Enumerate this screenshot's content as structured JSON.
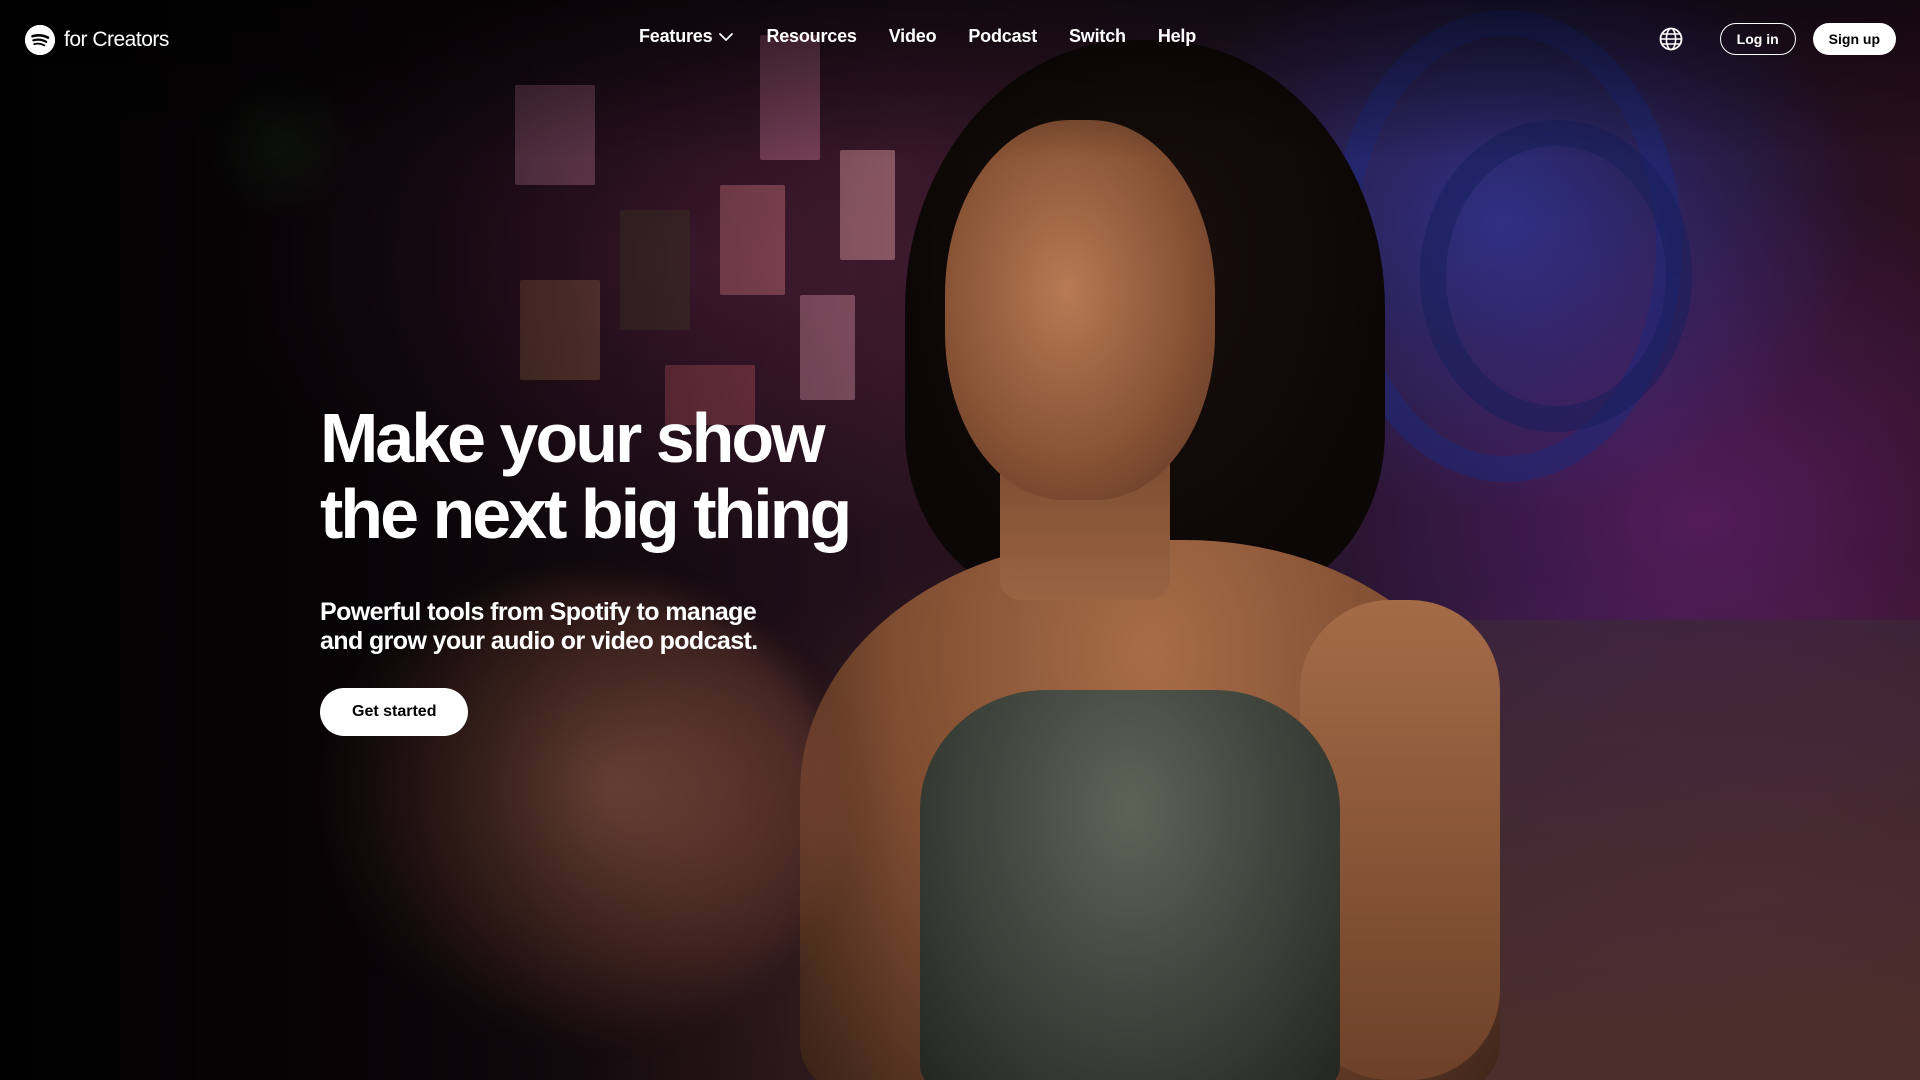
{
  "brand": {
    "logo_icon": "spotify-logo-icon",
    "text": "for Creators"
  },
  "nav": {
    "items": [
      {
        "label": "Features",
        "has_dropdown": true
      },
      {
        "label": "Resources"
      },
      {
        "label": "Video"
      },
      {
        "label": "Podcast"
      },
      {
        "label": "Switch"
      },
      {
        "label": "Help"
      }
    ]
  },
  "header_actions": {
    "language_icon": "globe-icon",
    "login_label": "Log in",
    "signup_label": "Sign up"
  },
  "hero": {
    "title_line1": "Make your show",
    "title_line2": "the next big thing",
    "subtitle_line1": "Powerful tools from Spotify to manage",
    "subtitle_line2": "and grow your audio or video podcast.",
    "cta_label": "Get started"
  },
  "colors": {
    "text": "#ffffff",
    "button_bg": "#ffffff",
    "button_text": "#000000"
  }
}
